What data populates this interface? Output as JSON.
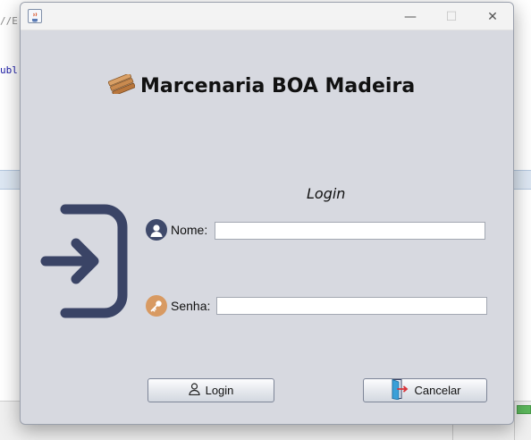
{
  "background_ide": {
    "code_line_1": "//E",
    "code_line_2": "ubl"
  },
  "window": {
    "icon": "java-cup-icon",
    "controls": {
      "minimize": "—",
      "maximize": "☐",
      "close": "✕"
    }
  },
  "header": {
    "icon": "wood-planks-icon",
    "title": "Marcenaria BOA Madeira"
  },
  "form": {
    "title": "Login",
    "side_icon": "login-arrow-icon",
    "nome": {
      "icon": "user-icon",
      "label": "Nome:",
      "value": ""
    },
    "senha": {
      "icon": "key-icon",
      "label": "Senha:",
      "value": ""
    }
  },
  "buttons": {
    "login": {
      "icon": "user-outline-icon",
      "label": "Login"
    },
    "cancel": {
      "icon": "door-exit-icon",
      "label": "Cancelar"
    }
  },
  "colors": {
    "window_bg": "#d7d9e0",
    "icon_navy": "#3a4466",
    "key_orange": "#d89a62"
  }
}
